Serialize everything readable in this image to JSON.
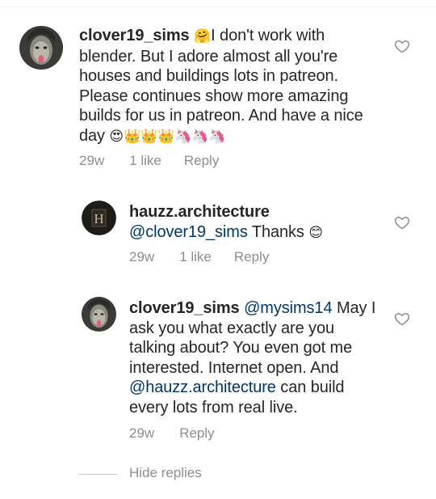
{
  "comments": [
    {
      "username": "clover19_sims",
      "emoji_lead": "🤗",
      "text": "I don't work with blender. But I adore almost all you're houses and buildings lots in patreon. Please continues show more amazing builds for us in patreon. And have a nice day",
      "emoji_tail": "😍👑👑👑🦄🦄🦄",
      "time": "29w",
      "likes": "1 like",
      "reply": "Reply"
    },
    {
      "username": "hauzz.architecture",
      "mention": "@clover19_sims",
      "text": "Thanks",
      "emoji_tail": "😊",
      "avatar_letter": "H",
      "time": "29w",
      "likes": "1 like",
      "reply": "Reply"
    },
    {
      "username": "clover19_sims",
      "mention": "@mysims14",
      "text_a": "May I ask you what exactly are you talking about? You even got me interested. Internet open. And",
      "mention2": "@hauzz.architecture",
      "text_b": "can build every lots from real live.",
      "time": "29w",
      "reply": "Reply"
    }
  ],
  "hide_replies": "Hide replies",
  "colors": {
    "text": "#262626",
    "meta": "#8e8e8e",
    "mention": "#00376b"
  }
}
